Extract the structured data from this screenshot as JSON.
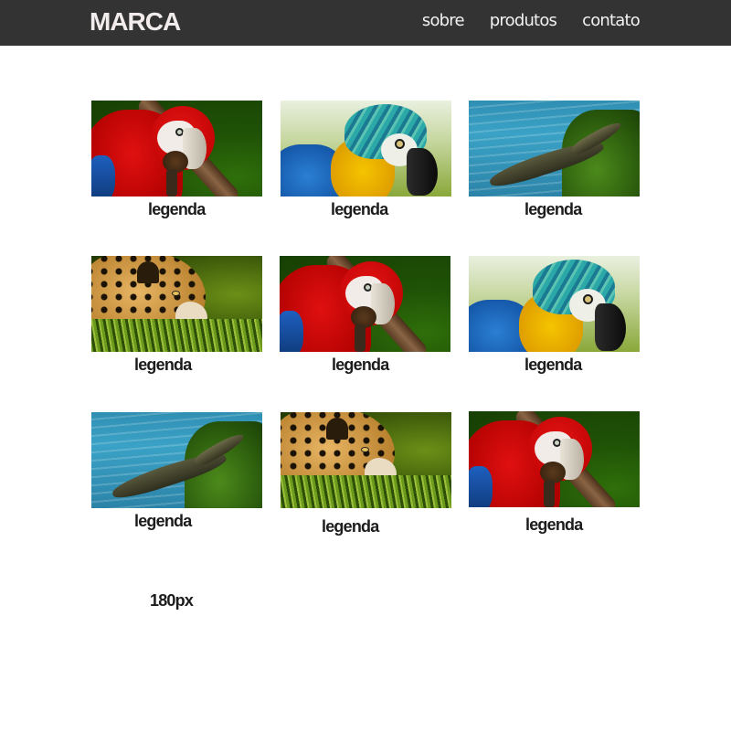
{
  "navbar": {
    "brand": "MARCA",
    "links": [
      "sobre",
      "produtos",
      "contato"
    ]
  },
  "gallery": {
    "tiles": [
      {
        "image": "scarlet-macaw",
        "caption": "legenda"
      },
      {
        "image": "blue-and-yellow-macaw",
        "caption": "legenda"
      },
      {
        "image": "caiman",
        "caption": "legenda"
      },
      {
        "image": "jaguar",
        "caption": "legenda"
      },
      {
        "image": "scarlet-macaw",
        "caption": "legenda"
      },
      {
        "image": "blue-and-yellow-macaw",
        "caption": "legenda"
      },
      {
        "image": "caiman",
        "caption": "legenda"
      },
      {
        "image": "jaguar",
        "caption": "legenda"
      },
      {
        "image": "scarlet-macaw",
        "caption": "legenda"
      }
    ],
    "note": "180px"
  },
  "colors": {
    "navbar_bg": "#333333",
    "brand": "#f3ecec",
    "nav_link": "#f2f2f2",
    "caption": "#1c1c1c"
  }
}
